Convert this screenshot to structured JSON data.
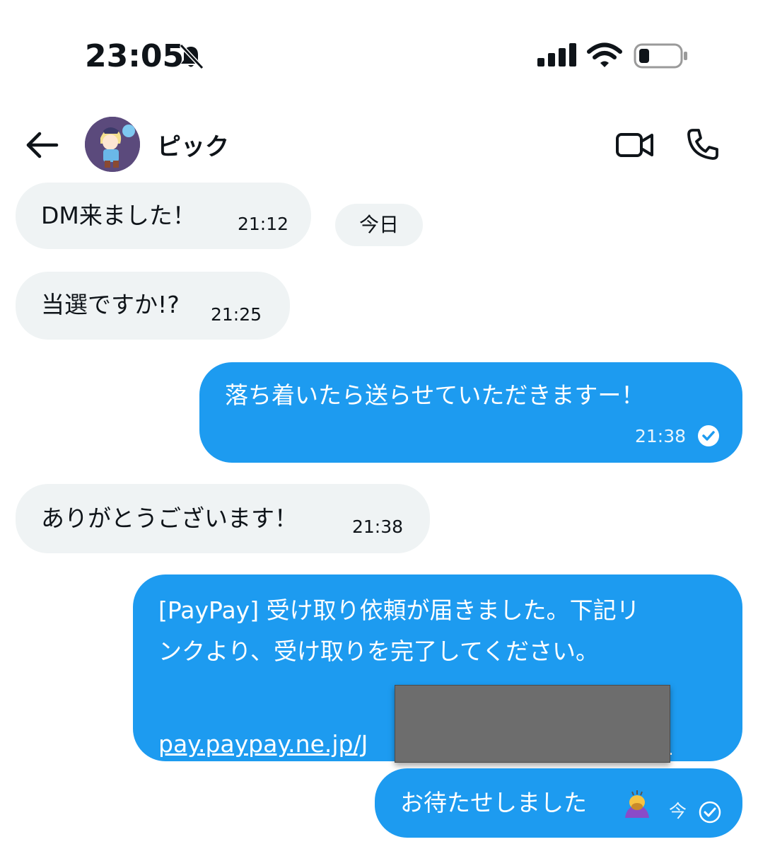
{
  "status_bar": {
    "time": "23:05"
  },
  "header": {
    "contact_name": "ピック"
  },
  "date_divider": "今日",
  "messages": [
    {
      "direction": "in",
      "text": "DM来ました！",
      "time": "21:12"
    },
    {
      "direction": "in",
      "text": "当選ですか!?",
      "time": "21:25"
    },
    {
      "direction": "out",
      "text": "落ち着いたら送らせていただきますー！",
      "time": "21:38"
    },
    {
      "direction": "in",
      "text": "ありがとうございます！",
      "time": "21:38"
    },
    {
      "direction": "out",
      "line1": "[PayPay] 受け取り依頼が届きました。下記リ",
      "line2": "ンクより、受け取りを完了してください。",
      "link": "pay.paypay.ne.jp/J"
    },
    {
      "direction": "out",
      "text": "お待たせしました",
      "time": "今"
    }
  ],
  "colors": {
    "outgoing_bubble": "#1d9bf0",
    "incoming_bubble": "#eff3f4"
  },
  "icons": [
    "back-arrow-icon",
    "bell-slash-icon",
    "cellular-signal-icon",
    "wifi-icon",
    "battery-icon",
    "video-call-icon",
    "phone-call-icon",
    "sent-check-icon",
    "person-bowing-emoji-icon"
  ]
}
